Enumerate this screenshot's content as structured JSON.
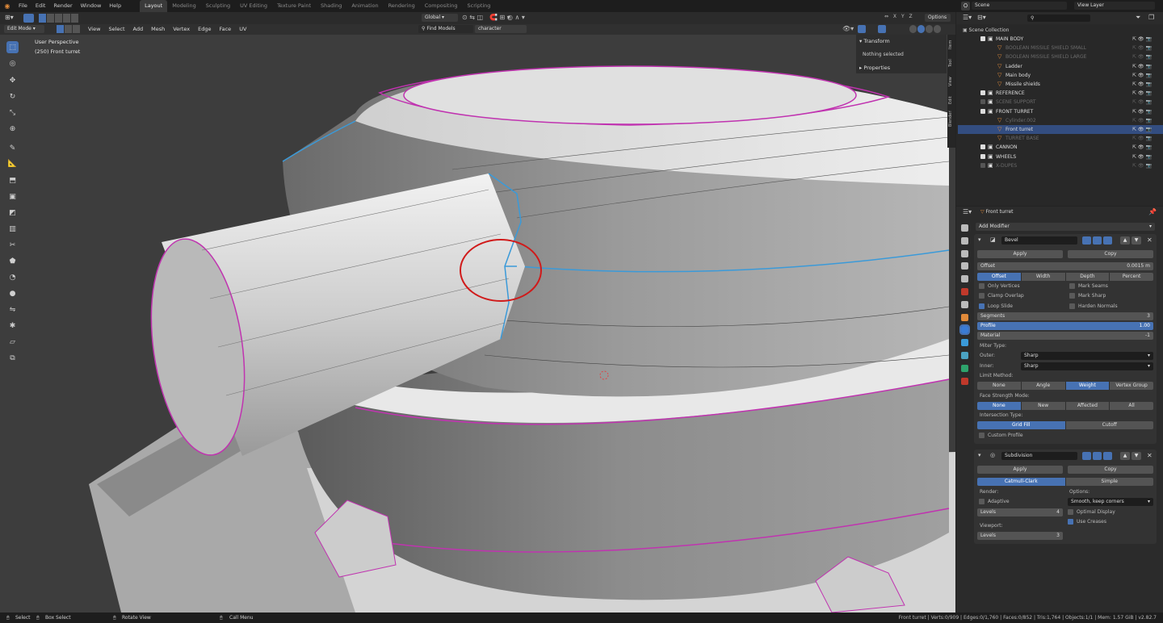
{
  "menu": [
    "File",
    "Edit",
    "Render",
    "Window",
    "Help"
  ],
  "workspaces": [
    {
      "label": "Layout",
      "active": true
    },
    {
      "label": "Modeling"
    },
    {
      "label": "Sculpting"
    },
    {
      "label": "UV Editing"
    },
    {
      "label": "Texture Paint"
    },
    {
      "label": "Shading"
    },
    {
      "label": "Animation"
    },
    {
      "label": "Rendering"
    },
    {
      "label": "Compositing"
    },
    {
      "label": "Scripting"
    }
  ],
  "top": {
    "orientation": "Global",
    "options": "Options",
    "scene": "Scene",
    "view_layer": "View Layer"
  },
  "viewport_header": {
    "mode": "Edit Mode",
    "menus": [
      "View",
      "Select",
      "Add",
      "Mesh",
      "Vertex",
      "Edge",
      "Face",
      "UV"
    ],
    "find_models": "Find Models",
    "search_value": "character"
  },
  "overlay_text": {
    "perspective": "User Perspective",
    "object": "(250) Front turret"
  },
  "npanel": {
    "transform": "Transform",
    "nothing_selected": "Nothing selected",
    "properties": "Properties",
    "tabs": [
      "Item",
      "Tool",
      "View",
      "Edit",
      "BlenderKit"
    ]
  },
  "outliner": {
    "root": "Scene Collection",
    "rows": [
      {
        "label": "MAIN BODY",
        "indent": 1,
        "type": "collection",
        "dim": false
      },
      {
        "label": "BOOLEAN MISSILE SHIELD SMALL",
        "indent": 2,
        "type": "mesh",
        "dim": true
      },
      {
        "label": "BOOLEAN MISSILE SHIELD LARGE",
        "indent": 2,
        "type": "mesh",
        "dim": true
      },
      {
        "label": "Ladder",
        "indent": 2,
        "type": "mesh",
        "dim": false
      },
      {
        "label": "Main body",
        "indent": 2,
        "type": "mesh",
        "dim": false
      },
      {
        "label": "Missile shields",
        "indent": 2,
        "type": "mesh",
        "dim": false
      },
      {
        "label": "REFERENCE",
        "indent": 1,
        "type": "collection",
        "dim": false
      },
      {
        "label": "SCENE SUPPORT",
        "indent": 1,
        "type": "collection",
        "dim": true
      },
      {
        "label": "FRONT TURRET",
        "indent": 1,
        "type": "collection",
        "dim": false
      },
      {
        "label": "Cylinder.002",
        "indent": 2,
        "type": "mesh",
        "dim": true
      },
      {
        "label": "Front turret",
        "indent": 2,
        "type": "mesh",
        "dim": false,
        "active": true
      },
      {
        "label": "TURRET BASE",
        "indent": 2,
        "type": "mesh",
        "dim": true
      },
      {
        "label": "CANNON",
        "indent": 1,
        "type": "collection",
        "dim": false
      },
      {
        "label": "WHEELS",
        "indent": 1,
        "type": "collection",
        "dim": false
      },
      {
        "label": "X-DUPES",
        "indent": 1,
        "type": "collection",
        "dim": true
      }
    ]
  },
  "properties": {
    "object": "Front turret",
    "add_modifier": "Add Modifier",
    "bevel": {
      "name": "Bevel",
      "apply": "Apply",
      "copy": "Copy",
      "offset_label": "Offset",
      "offset_value": "0.0015 m",
      "width_types": [
        "Offset",
        "Width",
        "Depth",
        "Percent"
      ],
      "checks_left": [
        {
          "label": "Only Vertices",
          "on": false
        },
        {
          "label": "Clamp Overlap",
          "on": false
        },
        {
          "label": "Loop Slide",
          "on": true
        }
      ],
      "checks_right": [
        {
          "label": "Mark Seams",
          "on": false
        },
        {
          "label": "Mark Sharp",
          "on": false
        },
        {
          "label": "Harden Normals",
          "on": false
        }
      ],
      "segments_label": "Segments",
      "segments": "3",
      "profile_label": "Profile",
      "profile": "1.00",
      "profile_fill": 1.0,
      "material_label": "Material",
      "material": "-1",
      "miter_label": "Miter Type:",
      "outer_label": "Outer:",
      "outer": "Sharp",
      "inner_label": "Inner:",
      "inner": "Sharp",
      "limit_label": "Limit Method:",
      "limit": [
        "None",
        "Angle",
        "Weight",
        "Vertex Group"
      ],
      "limit_active": 2,
      "face_label": "Face Strength Mode:",
      "face": [
        "None",
        "New",
        "Affected",
        "All"
      ],
      "face_active": 0,
      "inter_label": "Intersection Type:",
      "inter": [
        "Grid Fill",
        "Cutoff"
      ],
      "inter_active": 0,
      "custom_profile": "Custom Profile"
    },
    "subsurf": {
      "name": "Subdivision",
      "apply": "Apply",
      "copy": "Copy",
      "types": [
        "Catmull-Clark",
        "Simple"
      ],
      "render_label": "Render:",
      "options_label": "Options:",
      "adaptive": "Adaptive",
      "uv_smooth": "Smooth, keep corners",
      "levels_label": "Levels",
      "render_levels": "4",
      "optimal_display": "Optimal Display",
      "use_creases": "Use Creases",
      "viewport_label": "Viewport:",
      "viewport_levels": "3"
    }
  },
  "status": {
    "select": "Select",
    "box_select": "Box Select",
    "rotate_view": "Rotate View",
    "call_menu": "Call Menu",
    "stats": "Front turret | Verts:0/909 | Edges:0/1,760 | Faces:0/852 | Tris:1,764 | Objects:1/1 | Mem: 1.57 GiB | v2.82.7"
  }
}
